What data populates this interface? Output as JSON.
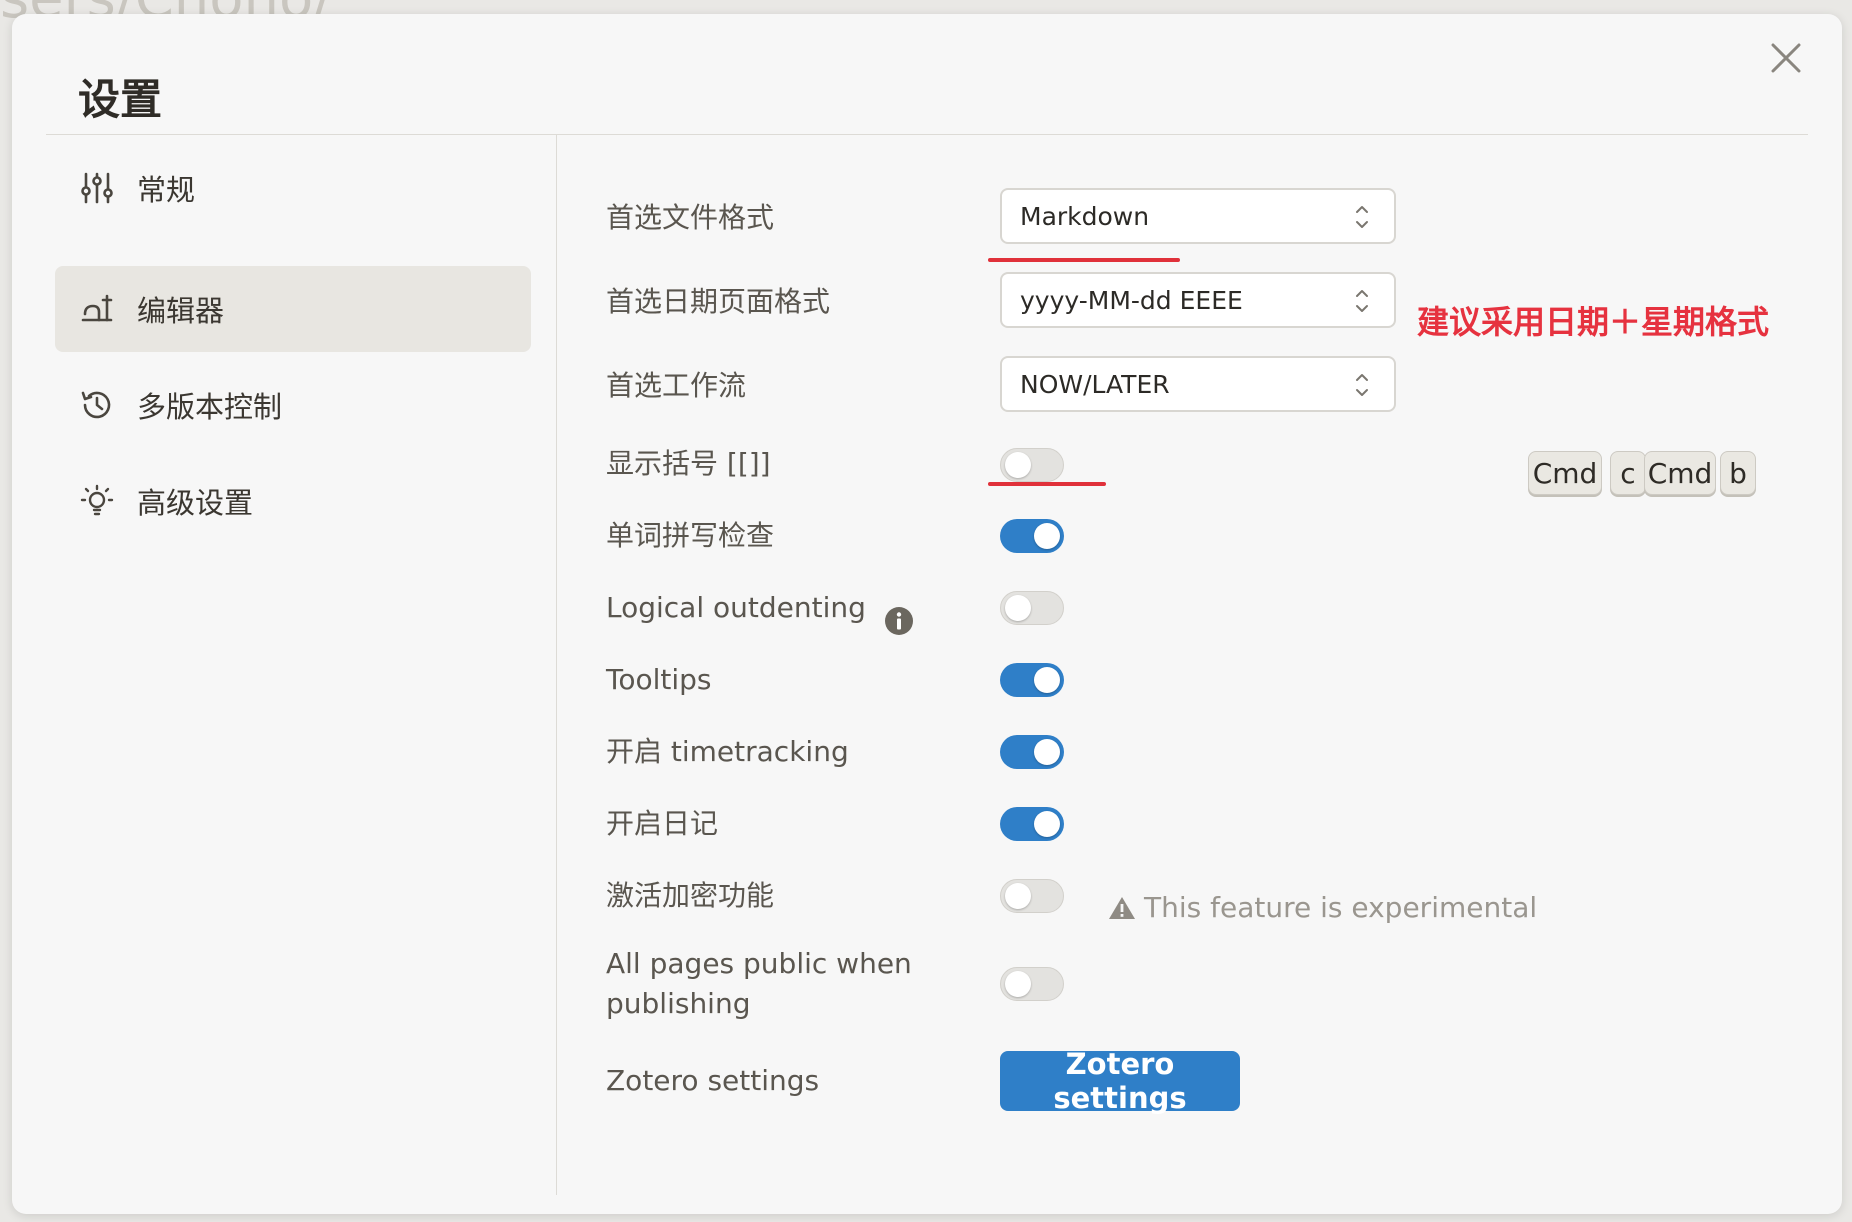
{
  "modal": {
    "title": "设置"
  },
  "sidebar": {
    "items": [
      {
        "label": "常规",
        "icon": "sliders-icon",
        "active": false
      },
      {
        "label": "编辑器",
        "icon": "editor-icon",
        "active": true
      },
      {
        "label": "多版本控制",
        "icon": "history-icon",
        "active": false
      },
      {
        "label": "高级设置",
        "icon": "lightbulb-icon",
        "active": false
      }
    ]
  },
  "settings": {
    "preferred_file_format": {
      "label": "首选文件格式",
      "value": "Markdown"
    },
    "preferred_date_format": {
      "label": "首选日期页面格式",
      "value": "yyyy-MM-dd EEEE"
    },
    "preferred_workflow": {
      "label": "首选工作流",
      "value": "NOW/LATER"
    },
    "show_brackets": {
      "label": "显示括号 [[]]",
      "enabled": false
    },
    "spell_check": {
      "label": "单词拼写检查",
      "enabled": true
    },
    "logical_outdenting": {
      "label": "Logical outdenting",
      "enabled": false
    },
    "tooltips": {
      "label": "Tooltips",
      "enabled": true
    },
    "timetracking": {
      "label": "开启 timetracking",
      "enabled": true
    },
    "journal": {
      "label": "开启日记",
      "enabled": true
    },
    "encryption": {
      "label": "激活加密功能",
      "enabled": false,
      "warning": "This feature is experimental"
    },
    "public_pages": {
      "label_line1": "All pages public when",
      "label_line2": "publishing",
      "enabled": false
    },
    "zotero": {
      "label": "Zotero settings",
      "button_label": "Zotero settings"
    }
  },
  "shortcut": {
    "keys": [
      "Cmd",
      "c",
      "Cmd",
      "b"
    ]
  },
  "annotation": {
    "text": "建议采用日期＋星期格式",
    "color": "#e6323f"
  },
  "colors": {
    "accent": "#2f7fc8",
    "annotation_red": "#e0313a"
  }
}
